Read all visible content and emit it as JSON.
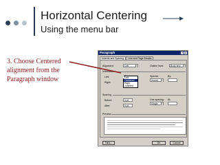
{
  "slide": {
    "title": "Horizontal Centering",
    "subtitle": "Using the menu bar",
    "callout": "3.  Choose Centered alignment from the Paragraph window"
  },
  "colors": {
    "title_text": "#1a1a1a",
    "accent_dark": "#2b3f55",
    "callout_text": "#8b1a1a",
    "pointer_line": "#8b1a1a",
    "dialog_face": "#d4d0c8",
    "dialog_titlebar": "#0a246a"
  },
  "dialog": {
    "title": "Paragraph",
    "title_buttons": [
      "?",
      "X"
    ],
    "tabs": [
      "Indents and Spacing",
      "Line and Page Breaks"
    ],
    "active_tab": 0,
    "alignment": {
      "label": "Alignment:",
      "value": "Left",
      "options": [
        "Left",
        "Centered",
        "Right",
        "Justified"
      ],
      "highlighted": "Centered"
    },
    "outline": {
      "label": "Outline level:",
      "value": "Body text"
    },
    "indentation": {
      "heading": "Indentation",
      "left_label": "Left:",
      "left_value": "0\"",
      "right_label": "Right:",
      "right_value": "0\"",
      "special_label": "Special:",
      "special_value": "(none)",
      "by_label": "By:"
    },
    "spacing": {
      "heading": "Spacing",
      "before_label": "Before:",
      "before_value": "0 pt",
      "after_label": "After:",
      "after_value": "0 pt",
      "line_label": "Line spacing:",
      "line_value": "Single",
      "at_label": "At:"
    },
    "preview": {
      "heading": "Preview"
    },
    "buttons": {
      "tabs": "Tabs...",
      "ok": "OK",
      "cancel": "Cancel"
    }
  }
}
